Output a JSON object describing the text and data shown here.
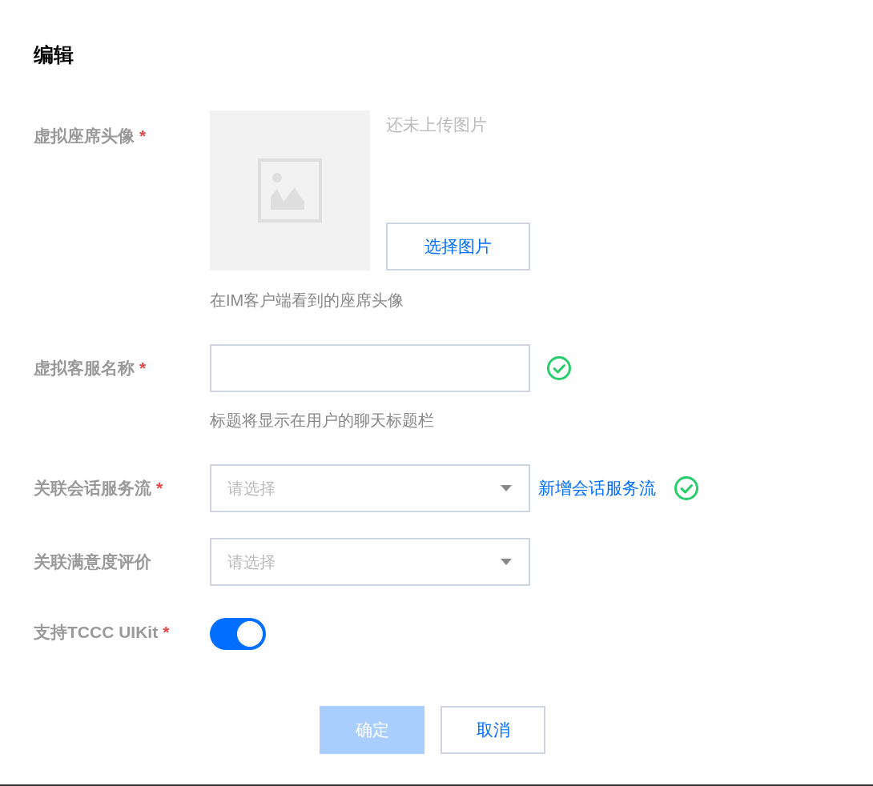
{
  "dialog": {
    "title": "编辑"
  },
  "fields": [
    {
      "kind": "upload",
      "label": "虚拟座席头像",
      "required_mark": "*",
      "status": "还未上传图片",
      "button": "选择图片",
      "hint": "在IM客户端看到的座席头像"
    },
    {
      "kind": "text",
      "label": "虚拟客服名称",
      "required_mark": "*",
      "valid": true,
      "hint": "标题将显示在用户的聊天标题栏"
    },
    {
      "kind": "select",
      "label": "关联会话服务流",
      "required_mark": "*",
      "placeholder": "请选择",
      "link": "新增会话服务流",
      "valid": true
    },
    {
      "kind": "select",
      "label": "关联满意度评价",
      "placeholder": "请选择"
    },
    {
      "kind": "toggle",
      "label": "支持TCCC UIKit",
      "required_mark": "*",
      "on": true
    }
  ],
  "footer": {
    "buttons": [
      {
        "label": "确定",
        "kind": "primary",
        "disabled": true
      },
      {
        "label": "取消",
        "kind": "secondary",
        "disabled": false
      }
    ]
  }
}
